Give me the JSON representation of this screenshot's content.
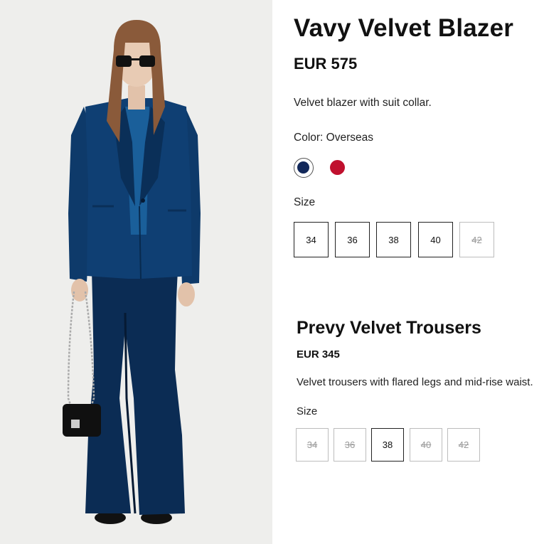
{
  "product_image": {
    "alt": "product-photo",
    "colors": {
      "background": "#eeeeec",
      "suit": "#0d3460",
      "suit_dark": "#07203f",
      "hair": "#8a5a3a"
    }
  },
  "blazer": {
    "title": "Vavy Velvet Blazer",
    "price": "EUR 575",
    "description": "Velvet blazer with suit collar.",
    "color_label": "Color: Overseas",
    "swatches": [
      {
        "name": "navy",
        "hex": "#12285a",
        "selected": true
      },
      {
        "name": "red",
        "hex": "#c0102e",
        "selected": false
      }
    ],
    "size_label": "Size",
    "sizes": [
      {
        "label": "34",
        "available": true
      },
      {
        "label": "36",
        "available": true
      },
      {
        "label": "38",
        "available": true
      },
      {
        "label": "40",
        "available": true
      },
      {
        "label": "42",
        "available": false
      }
    ]
  },
  "trousers": {
    "title": "Prevy Velvet Trousers",
    "price": "EUR 345",
    "description": "Velvet trousers with flared legs and mid-rise waist.",
    "size_label": "Size",
    "sizes": [
      {
        "label": "34",
        "available": false
      },
      {
        "label": "36",
        "available": false
      },
      {
        "label": "38",
        "available": true,
        "selected": true
      },
      {
        "label": "40",
        "available": false
      },
      {
        "label": "42",
        "available": false
      }
    ]
  }
}
